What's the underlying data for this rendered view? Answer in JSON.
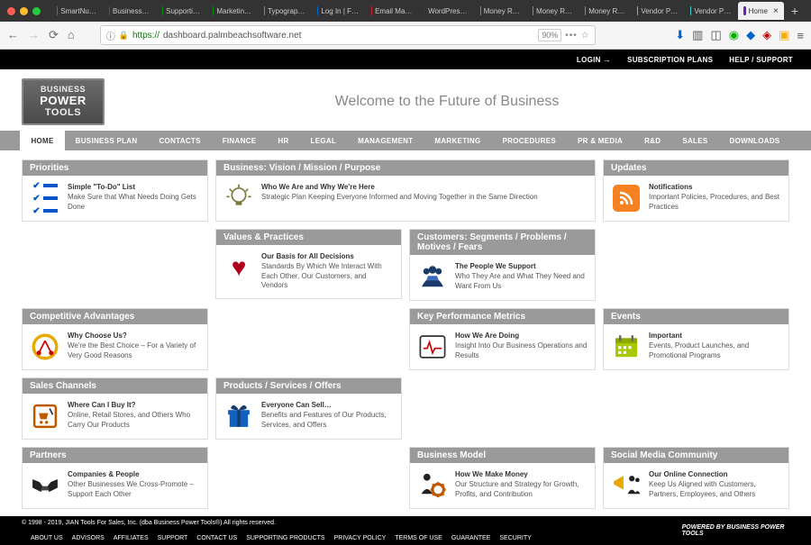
{
  "browser": {
    "tabs": [
      {
        "favicon_color": "#666",
        "label": "SmartNu…"
      },
      {
        "favicon_color": "#0a8a0a",
        "label": "Business…"
      },
      {
        "favicon_color": "#0a8a0a",
        "label": "Supporti…"
      },
      {
        "favicon_color": "#0a8a0a",
        "label": "Marketin…"
      },
      {
        "favicon_color": "#4a6",
        "label": "Typograp…"
      },
      {
        "favicon_color": "#06c",
        "label": "Log In | F…"
      },
      {
        "favicon_color": "#c22",
        "label": "Email Ma…"
      },
      {
        "favicon_color": "#337",
        "label": "WordPres…"
      },
      {
        "favicon_color": "#888",
        "label": "Money R…"
      },
      {
        "favicon_color": "#888",
        "label": "Money R…"
      },
      {
        "favicon_color": "#888",
        "label": "Money R…"
      },
      {
        "favicon_color": "#4cc",
        "label": "Vendor P…"
      },
      {
        "favicon_color": "#4cc",
        "label": "Vendor P…"
      },
      {
        "favicon_color": "#62b",
        "label": "Home",
        "active": true
      }
    ],
    "url_prefix": "https://",
    "url": "dashboard.palmbeachsoftware.net",
    "zoom": "90%"
  },
  "topbar": {
    "login": "LOGIN",
    "plans": "SUBSCRIPTION PLANS",
    "help": "HELP / SUPPORT"
  },
  "header": {
    "logo_l1": "BUSINESS",
    "logo_l2": "POWER",
    "logo_l3": "TOOLS",
    "welcome": "Welcome to the Future of Business"
  },
  "nav": {
    "items": [
      "HOME",
      "BUSINESS PLAN",
      "CONTACTS",
      "FINANCE",
      "HR",
      "LEGAL",
      "MANAGEMENT",
      "MARKETING",
      "PROCEDURES",
      "PR & MEDIA",
      "R&D",
      "SALES",
      "DOWNLOADS"
    ],
    "active_index": 0
  },
  "cards": {
    "priorities": {
      "hdr": "Priorities",
      "title": "Simple \"To-Do\" List",
      "desc": "Make Sure that What Needs Doing Gets Done"
    },
    "vision": {
      "hdr": "Business: Vision / Mission / Purpose",
      "title": "Who We Are and Why We're Here",
      "desc": "Strategic Plan Keeping Everyone Informed and Moving Together in the Same Direction"
    },
    "updates": {
      "hdr": "Updates",
      "title": "Notifications",
      "desc": "Important Policies, Procedures, and Best Practices"
    },
    "values": {
      "hdr": "Values & Practices",
      "title": "Our Basis for All Decisions",
      "desc": "Standards By Which We Interact With Each Other, Our Customers, and Vendors"
    },
    "customers": {
      "hdr": "Customers: Segments / Problems / Motives / Fears",
      "title": "The People We Support",
      "desc": "Who They Are and What They Need and Want From Us"
    },
    "comp": {
      "hdr": "Competitive Advantages",
      "title": "Why Choose Us?",
      "desc": "We're the Best Choice – For a Variety of Very Good Reasons"
    },
    "kpi": {
      "hdr": "Key Performance Metrics",
      "title": "How We Are Doing",
      "desc": "Insight Into Our Business Operations and Results"
    },
    "events": {
      "hdr": "Events",
      "title": "Important",
      "desc": "Events, Product Launches, and Promotional Programs"
    },
    "sales": {
      "hdr": "Sales Channels",
      "title": "Where Can I Buy It?",
      "desc": "Online, Retail Stores, and Others Who Carry Our Products"
    },
    "products": {
      "hdr": "Products / Services / Offers",
      "title": "Everyone Can Sell…",
      "desc": "Benefits and Features of Our Products, Services, and Offers"
    },
    "partners": {
      "hdr": "Partners",
      "title": "Companies & People",
      "desc": "Other Businesses We Cross-Promote – Support Each Other"
    },
    "bizmodel": {
      "hdr": "Business Model",
      "title": "How We Make Money",
      "desc": "Our Structure and Strategy for Growth, Profits, and Contribution"
    },
    "social": {
      "hdr": "Social Media Community",
      "title": "Our Online Connection",
      "desc": "Keep Us Aligned with Customers, Partners, Employees, and Others"
    }
  },
  "footer": {
    "copyright": "© 1998 - 2019, JIAN Tools For Sales, Inc. (dba Business Power Tools®) All rights reserved.",
    "links": [
      "ABOUT US",
      "ADVISORS",
      "AFFILIATES",
      "SUPPORT",
      "CONTACT US",
      "SUPPORTING PRODUCTS",
      "PRIVACY POLICY",
      "TERMS OF USE",
      "GUARANTEE",
      "SECURITY"
    ],
    "powered": "POWERED BY BUSINESS POWER TOOLS"
  }
}
